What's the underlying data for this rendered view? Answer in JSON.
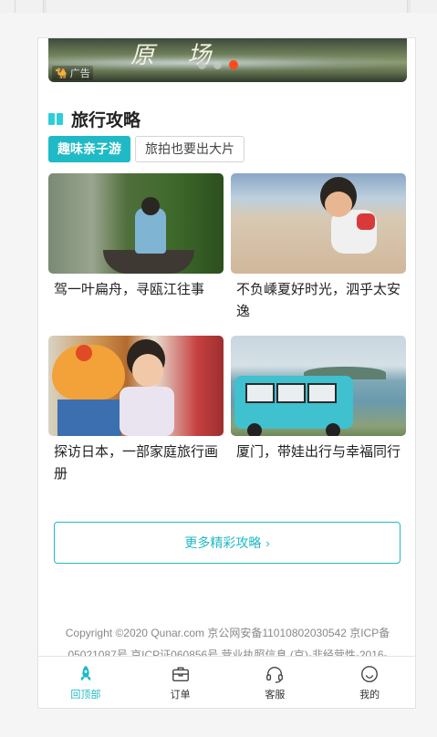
{
  "banner": {
    "calligraphy": "原 场",
    "ad_label": "广告",
    "slide_count": 3,
    "active_slide": 3
  },
  "section": {
    "title": "旅行攻略",
    "icon": "book-icon"
  },
  "tabs": [
    {
      "label": "趣味亲子游",
      "active": true
    },
    {
      "label": "旅拍也要出大片",
      "active": false
    }
  ],
  "cards": [
    {
      "title": "驾一叶扁舟，寻瓯江往事"
    },
    {
      "title": "不负嵊夏好时光，泗乎太安逸"
    },
    {
      "title": "探访日本，一部家庭旅行画册"
    },
    {
      "title": "厦门，带娃出行与幸福同行"
    }
  ],
  "more_button": {
    "label": "更多精彩攻略",
    "icon": "chevron-right-icon"
  },
  "footer": {
    "line1": "Copyright ©2020 Qunar.com  京公网安备11010802030542  京ICP备",
    "line2": "05021087号  京ICP证060856号  营业执照信息  (京)-非经营性-2016-"
  },
  "tabbar": [
    {
      "label": "回顶部",
      "icon": "rocket-icon",
      "active": true
    },
    {
      "label": "订单",
      "icon": "briefcase-icon",
      "active": false
    },
    {
      "label": "客服",
      "icon": "headset-icon",
      "active": false
    },
    {
      "label": "我的",
      "icon": "smiley-icon",
      "active": false
    }
  ],
  "colors": {
    "accent": "#1fbac6",
    "banner_dot_active": "#ff4a1a"
  }
}
